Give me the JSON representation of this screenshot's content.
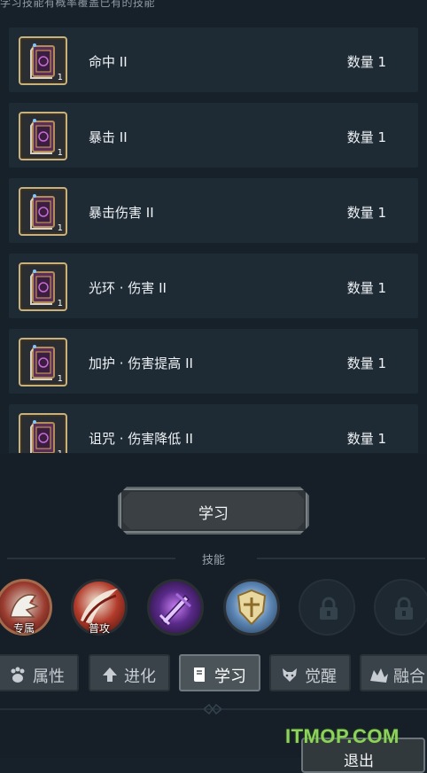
{
  "header": {
    "note": "学习技能有概率覆盖已有的技能"
  },
  "skill_books": [
    {
      "name": "命中 II",
      "quantity": "数量 1",
      "count_badge": "1"
    },
    {
      "name": "暴击 II",
      "quantity": "数量 1",
      "count_badge": "1"
    },
    {
      "name": "暴击伤害 II",
      "quantity": "数量 1",
      "count_badge": "1"
    },
    {
      "name": "光环 · 伤害 II",
      "quantity": "数量 1",
      "count_badge": "1"
    },
    {
      "name": "加护 · 伤害提高 II",
      "quantity": "数量 1",
      "count_badge": "1"
    },
    {
      "name": "诅咒 · 伤害降低 II",
      "quantity": "数量 1",
      "count_badge": "1"
    }
  ],
  "actions": {
    "learn_label": "学习",
    "exit_label": "退出"
  },
  "skills": {
    "title": "技能",
    "slots": [
      {
        "label": "专属",
        "icon": "wolf-claw-icon"
      },
      {
        "label": "普攻",
        "icon": "slash-icon"
      },
      {
        "label": "",
        "icon": "purple-sword-icon"
      },
      {
        "label": "",
        "icon": "golden-shield-icon"
      },
      {
        "label": "",
        "icon": "lock-icon"
      },
      {
        "label": "",
        "icon": "lock-icon"
      }
    ]
  },
  "tabs": [
    {
      "label": "属性",
      "icon": "paw-icon"
    },
    {
      "label": "进化",
      "icon": "arrow-up-icon"
    },
    {
      "label": "学习",
      "icon": "book-icon",
      "active": true
    },
    {
      "label": "觉醒",
      "icon": "beast-icon"
    },
    {
      "label": "融合",
      "icon": "fusion-icon"
    }
  ],
  "watermark": "ITMOP.COM",
  "colors": {
    "background": "#17212a",
    "row": "#1f2b34",
    "accent_gold": "#c7b17d",
    "watermark": "#8dd25b"
  }
}
